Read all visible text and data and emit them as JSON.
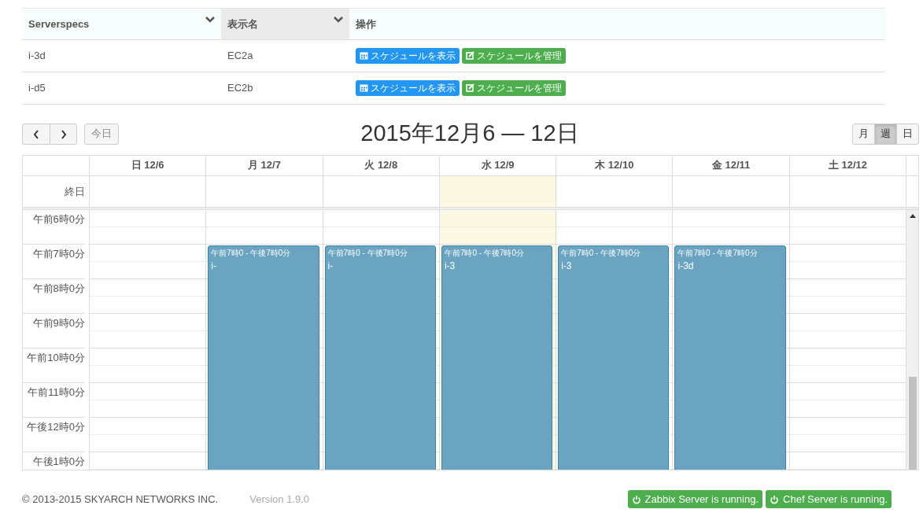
{
  "table": {
    "columns": [
      {
        "label": "Serverspecs",
        "sortable": true,
        "sorted": false
      },
      {
        "label": "表示名",
        "sortable": true,
        "sorted": true
      },
      {
        "label": "操作",
        "sortable": false,
        "sorted": false
      }
    ],
    "rows": [
      {
        "cells": [
          "i-3d",
          "EC2a"
        ],
        "actions": [
          {
            "kind": "view",
            "label": "スケジュールを表示"
          },
          {
            "kind": "manage",
            "label": "スケジュールを管理"
          }
        ]
      },
      {
        "cells": [
          "i-d5",
          "EC2b"
        ],
        "actions": [
          {
            "kind": "view",
            "label": "スケジュールを表示"
          },
          {
            "kind": "manage",
            "label": "スケジュールを管理"
          }
        ]
      }
    ]
  },
  "toolbar": {
    "today": {
      "label": "今日",
      "disabled": true
    },
    "title": "2015年12月6 — 12日",
    "views": [
      {
        "label": "月",
        "selected": false
      },
      {
        "label": "週",
        "selected": true
      },
      {
        "label": "日",
        "selected": false
      }
    ]
  },
  "calendar": {
    "allday_label": "終日",
    "days": [
      {
        "label": "日 12/6",
        "today": false
      },
      {
        "label": "月 12/7",
        "today": false,
        "events": [
          {
            "time": "午前7時0 - 午後7時0分",
            "title": "i-"
          }
        ]
      },
      {
        "label": "火 12/8",
        "today": false,
        "events": [
          {
            "time": "午前7時0 - 午後7時0分",
            "title": "i-"
          }
        ]
      },
      {
        "label": "水 12/9",
        "today": true,
        "events": [
          {
            "time": "午前7時0 - 午後7時0分",
            "title": "i-3"
          }
        ]
      },
      {
        "label": "木 12/10",
        "today": false,
        "events": [
          {
            "time": "午前7時0 - 午後7時0分",
            "title": "i-3"
          }
        ]
      },
      {
        "label": "金 12/11",
        "today": false,
        "events": [
          {
            "time": "午前7時0 - 午後7時0分",
            "title": "i-3d"
          }
        ]
      },
      {
        "label": "土 12/12",
        "today": false
      }
    ],
    "times": [
      "午前6時0分",
      "午前7時0分",
      "午前8時0分",
      "午前9時0分",
      "午前10時0分",
      "午前11時0分",
      "午後12時0分",
      "午後1時0分"
    ]
  },
  "footer": {
    "copyright": "© 2013-2015 SKYARCH NETWORKS INC.",
    "version": "Version 1.9.0",
    "statuses": [
      {
        "label": "Zabbix Server is running.",
        "running": true
      },
      {
        "label": "Chef Server is running.",
        "running": true
      }
    ]
  }
}
